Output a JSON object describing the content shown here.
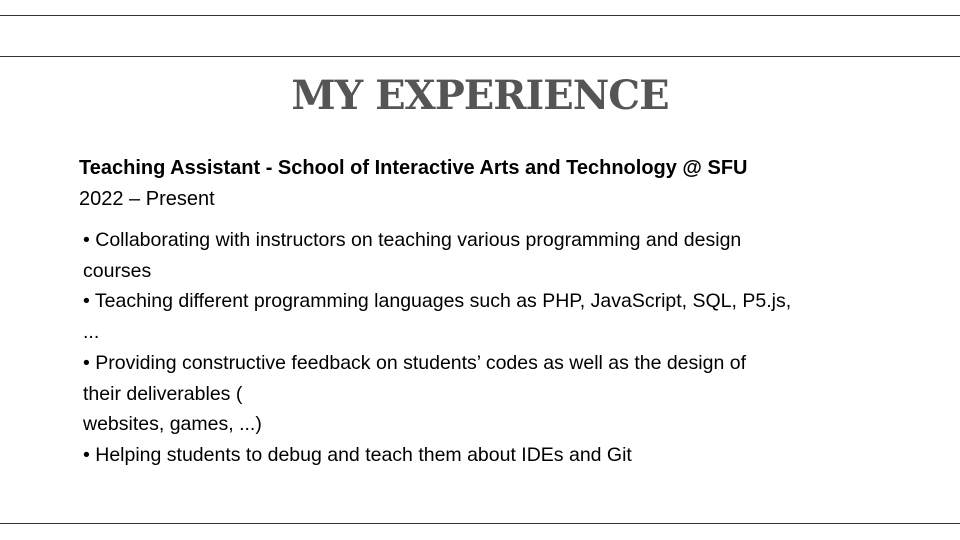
{
  "slide": {
    "title": "MY EXPERIENCE",
    "job": {
      "title": "Teaching Assistant - School of Interactive Arts and Technology @ SFU",
      "dates": "2022 – Present"
    },
    "bullet_lines": [
      "• Collaborating with instructors on teaching various programming and design",
      "courses",
      " • Teaching different programming languages such as PHP, JavaScript, SQL, P5.js,",
      "...",
      " • Providing constructive feedback on students’ codes as well as the design of",
      "their deliverables (",
      " websites, games, ...)",
      " • Helping students to debug and teach them about IDEs and Git"
    ]
  }
}
